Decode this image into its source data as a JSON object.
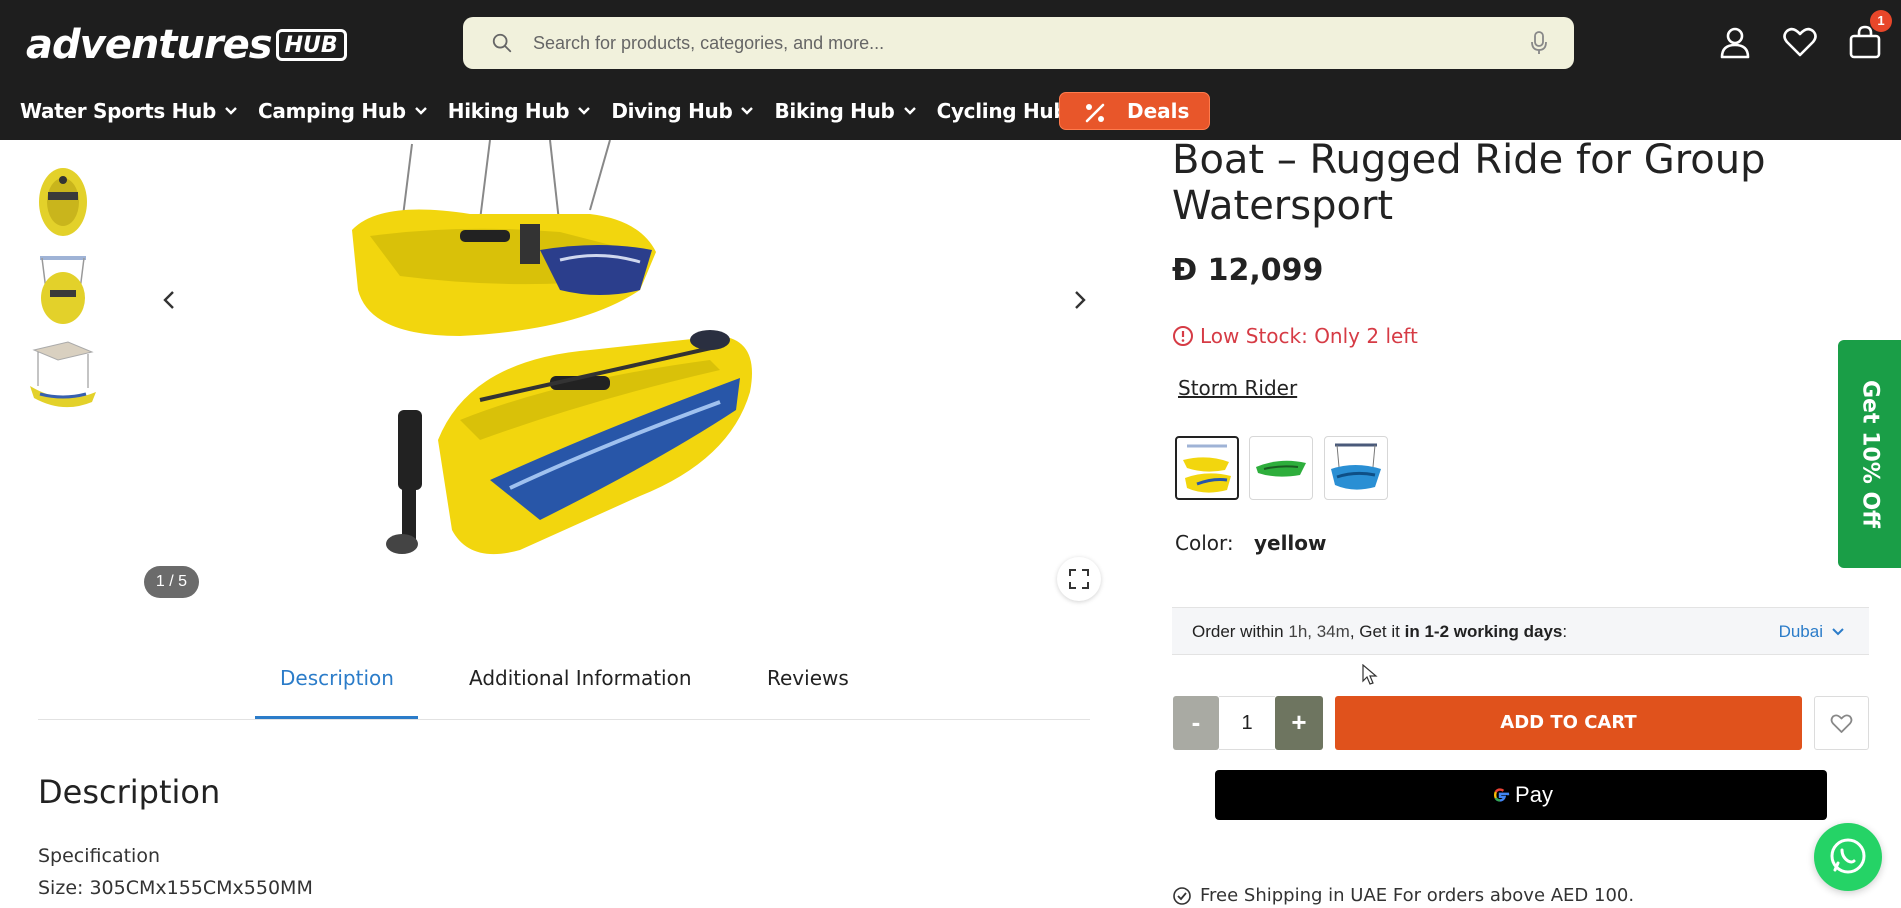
{
  "header": {
    "logo_main": "adventures",
    "logo_badge": "HUB",
    "search_placeholder": "Search for products, categories, and more...",
    "cart_count": "1"
  },
  "nav": {
    "items": [
      {
        "label": "Water Sports Hub"
      },
      {
        "label": "Camping Hub"
      },
      {
        "label": "Hiking Hub"
      },
      {
        "label": "Diving Hub"
      },
      {
        "label": "Biking Hub"
      },
      {
        "label": "Cycling Hub"
      }
    ],
    "deals_label": "Deals"
  },
  "gallery": {
    "counter": "1 / 5"
  },
  "tabs": {
    "description": "Description",
    "additional": "Additional Information",
    "reviews": "Reviews"
  },
  "description": {
    "title": "Description",
    "spec_heading": "Specification",
    "size": "Size: 305CMx155CMx550MM"
  },
  "product": {
    "title_line1": "Boat – Rugged Ride for Group",
    "title_line2": "Watersport",
    "currency_symbol": "Đ",
    "price": "12,099",
    "stock": "Low Stock: Only 2 left",
    "brand": "Storm Rider",
    "color_label": "Color:",
    "color_value": "yellow"
  },
  "delivery": {
    "prefix": "Order within",
    "time": "1h, 34m",
    "mid": ", Get it",
    "days": "in 1-2 working days",
    "suffix": ":",
    "location": "Dubai"
  },
  "purchase": {
    "minus": "-",
    "quantity": "1",
    "plus": "+",
    "add_to_cart": "ADD TO CART",
    "gpay_label": "Pay",
    "shipping": "Free Shipping in UAE For orders above AED 100."
  },
  "promo": {
    "label": "Get 10% Off"
  },
  "colors": {
    "header_bg": "#1e1e1e",
    "accent_orange": "#e0521c",
    "link_blue": "#2b7cc9",
    "stock_red": "#d63b45",
    "promo_green": "#1a9e47"
  }
}
